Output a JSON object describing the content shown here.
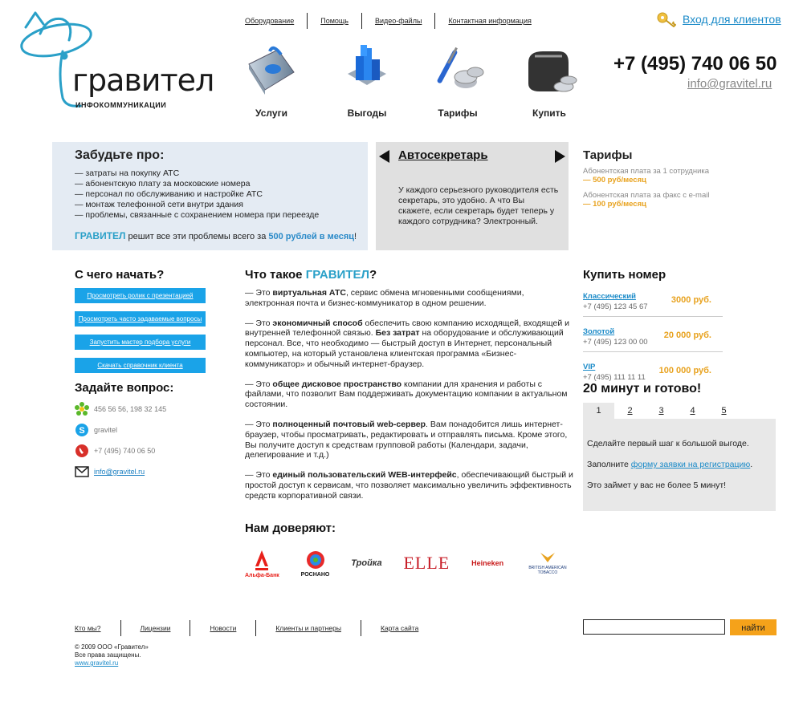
{
  "brand": {
    "name": "гравител",
    "tagline": "ИНФОКОММУНИКАЦИИ"
  },
  "topnav": {
    "items": [
      "Оборудование",
      "Помощь",
      "Видео-файлы",
      "Контактная информация"
    ]
  },
  "login": {
    "label": "Вход для клиентов"
  },
  "contacts_header": {
    "phone": "+7 (495) 740 06 50",
    "email": "info@gravitel.ru"
  },
  "services": [
    {
      "label": "Услуги",
      "icon": "book-icon"
    },
    {
      "label": "Выгоды",
      "icon": "blocks-icon"
    },
    {
      "label": "Тарифы",
      "icon": "tools-icon"
    },
    {
      "label": "Купить",
      "icon": "wallet-icon"
    }
  ],
  "forget": {
    "title": "Забудьте про:",
    "items": [
      "— затраты на покупку АТС",
      "— абонентскую плату за московские номера",
      "— персонал по обслуживанию и настройке АТС",
      "— монтаж телефонной сети внутри здания",
      "— проблемы, связанные с сохранением номера при переезде"
    ],
    "bottom_brand": "ГРАВИТЕЛ",
    "bottom_mid": " решит все эти проблемы всего за ",
    "bottom_price": "500 рублей в месяц",
    "bottom_end": "!"
  },
  "slider": {
    "title": "Автосекретарь",
    "text": "У каждого серьезного руководителя есть секретарь, это удобно. А что Вы скажете, если секретарь будет теперь у каждого сотрудника? Электронный."
  },
  "tariffs": {
    "title": "Тарифы",
    "rows": [
      {
        "label": "Абонентская плата за 1 сотрудника",
        "value": "— 500 руб/месяц"
      },
      {
        "label": "Абонентская плата за факс с e-mail",
        "value": "— 100 руб/месяц"
      }
    ]
  },
  "start": {
    "title": "С чего начать?",
    "buttons": [
      "Просмотреть ролик с презентацией",
      "Просмотреть часто задаваемые вопросы",
      "Запустить мастер подбора услуги",
      "Скачать справочник клиента"
    ]
  },
  "ask": {
    "title": "Задайте вопрос:",
    "icq": "456 56 56, 198 32 145",
    "skype": "gravitel",
    "phone": "+7 (495) 740 06 50",
    "email": "info@gravitel.ru"
  },
  "what": {
    "title_prefix": "Что такое ",
    "title_brand": "ГРАВИТЕЛ",
    "title_suffix": "?",
    "p1_a": "— Это ",
    "p1_b": "виртуальная АТС",
    "p1_c": ",  сервис обмена мгновенными сообщениями, электронная почта и бизнес-коммуникатор в одном решении.",
    "p2_a": "— Это ",
    "p2_b": "экономичный способ",
    "p2_c": " обеспечить свою компанию исходящей, входящей и внутренней телефонной связью. ",
    "p2_d": "Без затрат",
    "p2_e": " на оборудование и обслуживающий персонал. Все, что необходимо  — быстрый доступ в Интернет, персональный компьютер, на который установлена клиентская программа «Бизнес-коммуникатор» и обычный интернет-браузер.",
    "p3_a": "— Это ",
    "p3_b": "общее дисковое пространство",
    "p3_c": " компании для хранения и работы с файлами, что позволит Вам поддерживать документацию компании в актуальном  состоянии.",
    "p4_a": "— Это ",
    "p4_b": "полноценный почтовый web-сервер",
    "p4_c": ". Вам понадобится лишь интернет-браузер, чтобы просматривать, редактировать и отправлять письма. Кроме этого, Вы получите доступ к средствам групповой работы (Календари, задачи, делегирование и т.д.)",
    "p5_a": "— Это ",
    "p5_b": "единый пользовательский WEB-интерфейс",
    "p5_c": ", обеспечивающий быстрый и простой доступ к сервисам, что позволяет максимально увеличить эффективность средств корпоративной связи."
  },
  "trust": {
    "title": "Нам доверяют:",
    "logos": [
      "Альфа-Банк",
      "РОСНАНО",
      "Тройка",
      "ELLE",
      "Heineken",
      "BRITISH AMERICAN TOBACCO"
    ]
  },
  "buy": {
    "title": "Купить номер",
    "rows": [
      {
        "name": "Классический",
        "phone": "+7 (495) 123 45 67",
        "price": "3000 руб."
      },
      {
        "name": "Золотой",
        "phone": "+7 (495) 123 00 00",
        "price": "20 000 руб."
      },
      {
        "name": "VIP",
        "phone": "+7 (495) 111 11 11",
        "price": "100 000 руб."
      }
    ]
  },
  "twenty": {
    "title": "20 минут и готово!",
    "tabs": [
      "1",
      "2",
      "3",
      "4",
      "5"
    ],
    "line1": "Сделайте первый  шаг к большой выгоде.",
    "line2_a": "Заполните ",
    "line2_link": "форму заявки на регистрацию",
    "line2_b": ".",
    "line3": "Это займет у вас не более 5 минут!"
  },
  "footer": {
    "nav": [
      "Кто мы?",
      "Лицензии",
      "Новости",
      "Клиенты и партнеры",
      "Карта сайта"
    ],
    "copy1": "© 2009 ООО «Гравител»",
    "copy2": "Все права защищены.",
    "site": "www.gravitel.ru",
    "search_button": "найти"
  },
  "colors": {
    "accent_blue": "#1aa3e8",
    "accent_orange": "#f5a21a",
    "brand_teal": "#2aa0c8"
  }
}
